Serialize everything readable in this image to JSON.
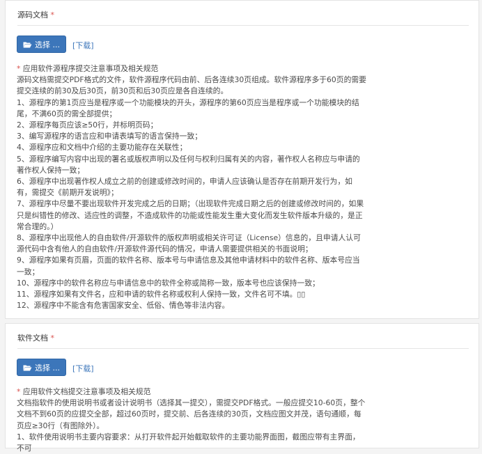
{
  "source_doc": {
    "title": "源码文档",
    "required_mark": "*",
    "select_label": "选择 ...",
    "download_label": "[下载]",
    "notes_heading_star": "*",
    "notes_heading": " 应用软件源程序提交注意事项及相关规范",
    "notes": [
      "源码文档需提交PDF格式的文件，软件源程序代码由前、后各连续30页组成。软件源程序多于60页的需要提交连续的前30及后30页，前30页和后30页应是各自连续的。",
      "1、源程序的第1页应当是程序或一个功能模块的开头，源程序的第60页应当是程序或一个功能模块的结尾，不满60页的需全部提供；",
      "2、源程序每页应该≥50行，并标明页码；",
      "3、编写源程序的语言应和申请表填写的语言保持一致；",
      "4、源程序应和文档中介绍的主要功能存在关联性；",
      "5、源程序编写内容中出现的署名或版权声明以及任何与权利归属有关的内容，著作权人名称应与申请的著作权人保持一致；",
      "6、源程序中出现著作权人成立之前的创建或修改时间的，申请人应该确认是否存在前期开发行为，如有，需提交《前期开发说明》；",
      "7、源程序中尽量不要出现软件开发完成之后的日期；（出现软件完成日期之后的创建或修改时间的，如果只是纠错性的修改、适应性的调整，不造成软件的功能或性能发生重大变化而发生软件版本升级的，是正常合理的。）",
      "8、源程序中出现他人的自由软件/开源软件的版权声明或相关许可证（License）信息的，且申请人认可源代码中含有他人的自由软件/开源软件源代码的情况，申请人需要提供相关的书面说明；",
      "9、源程序如果有页眉，页面的软件名称、版本号与申请信息及其他申请材料中的软件名称、版本号应当一致；",
      "10、源程序中的软件名称应与申请信息中的软件全称或简称一致，版本号也应该保持一致；",
      "11、源程序如果有文件名，应和申请的软件名称或权利人保持一致，文件名可不填。▯▯",
      "12、源程序中不能含有危害国家安全、低俗、情色等非法内容。"
    ]
  },
  "software_doc": {
    "title": "软件文档",
    "required_mark": "*",
    "select_label": "选择 ...",
    "download_label": "[下载]",
    "notes_heading_star": "*",
    "notes_heading": " 应用软件文档提交注意事项及相关规范",
    "notes": [
      "文档指软件的使用说明书或者设计说明书（选择其一提交），需提交PDF格式。一般应提交10-60页，整个文档不到60页的应提交全部，超过60页时，提交前、后各连续的30页，文档应图文并茂，语句通顺，每页应≥30行（有图除外）。",
      "1、软件使用说明书主要内容要求：从打开软件起开始截取软件的主要功能界面图，截图应带有主界面，不可"
    ]
  },
  "colors": {
    "accent": "#3c76ba",
    "required": "#d9534f"
  },
  "icons": {
    "select_button_icon": "folder-open-icon"
  }
}
